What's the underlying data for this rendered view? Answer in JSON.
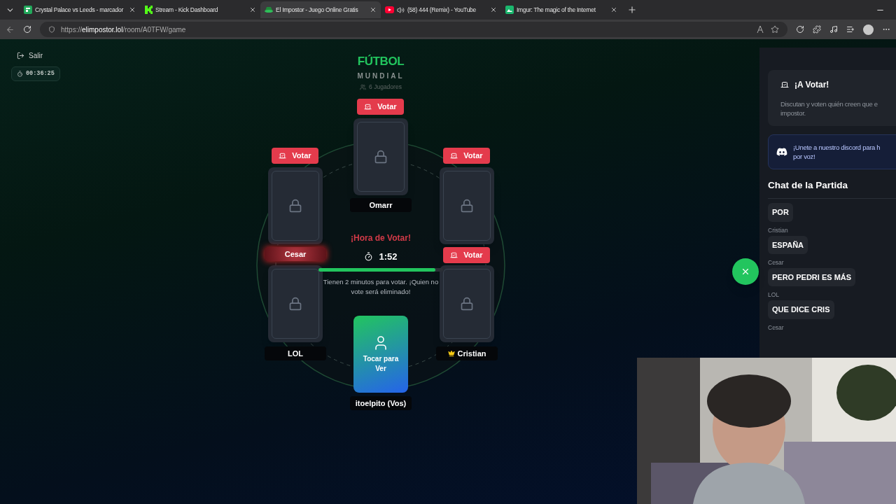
{
  "browser": {
    "tabs": [
      {
        "title": "Crystal Palace vs Leeds - marcador",
        "kind": "sheet",
        "audio": false,
        "selected": false
      },
      {
        "title": "Stream - Kick Dashboard",
        "kind": "kick",
        "audio": false,
        "selected": false
      },
      {
        "title": "El Impostor - Juego Online Gratis",
        "kind": "impostor",
        "audio": false,
        "selected": true
      },
      {
        "title": "(58) 444 (Remix) - YouTube",
        "kind": "youtube",
        "audio": true,
        "selected": false
      },
      {
        "title": "Imgur: The magic of the Internet",
        "kind": "imgur",
        "audio": false,
        "selected": false
      }
    ],
    "url": {
      "scheme": "https://",
      "host": "elimpostor.lol",
      "path": "/room/A0TFW/game"
    }
  },
  "exit": {
    "label": "Salir"
  },
  "elapsed": "00:36:25",
  "game": {
    "category": "FÚTBOL",
    "subcategory": "MUNDIAL",
    "players_count": "6 Jugadores"
  },
  "players": [
    {
      "name": "Omarr",
      "vote_button": "Votar",
      "kind": "locked",
      "highlighted": false,
      "host": false
    },
    {
      "name": "Cesar",
      "vote_button": "Votar",
      "kind": "locked",
      "highlighted": true,
      "host": false
    },
    {
      "vote_button": "Votar",
      "kind": "locked"
    },
    {
      "name": "LOL",
      "kind": "locked",
      "highlighted": false,
      "host": false
    },
    {
      "name": "Cristian",
      "vote_button": "Votar",
      "kind": "locked",
      "highlighted": false,
      "host": true
    },
    {
      "name": "itoelpito (Vos)",
      "kind": "own",
      "card_label": "Tocar para Ver",
      "highlighted": false,
      "host": false
    }
  ],
  "voting": {
    "heading": "¡Hora de Votar!",
    "countdown": "1:52",
    "level": 0.94,
    "message": "Tienen 2 minutos para votar. ¡Quien no vote será eliminado!"
  },
  "panel": {
    "phase_title": "¡A Votar!",
    "phase_lines": [
      "Discutan y voten quién creen que e",
      "impostor."
    ],
    "discord_lines": [
      "¡Unete a nuestro discord para h",
      "por voz!"
    ],
    "chat_title": "Chat de la Partida",
    "messages": [
      {
        "text": "POR"
      },
      {
        "author": "Cristian",
        "text": "ESPAÑA"
      },
      {
        "author": "Cesar",
        "text": "PERO PEDRI ES MÁS"
      },
      {
        "author": "LOL",
        "text": "QUE DICE CRIS"
      },
      {
        "author": "Cesar"
      }
    ]
  }
}
